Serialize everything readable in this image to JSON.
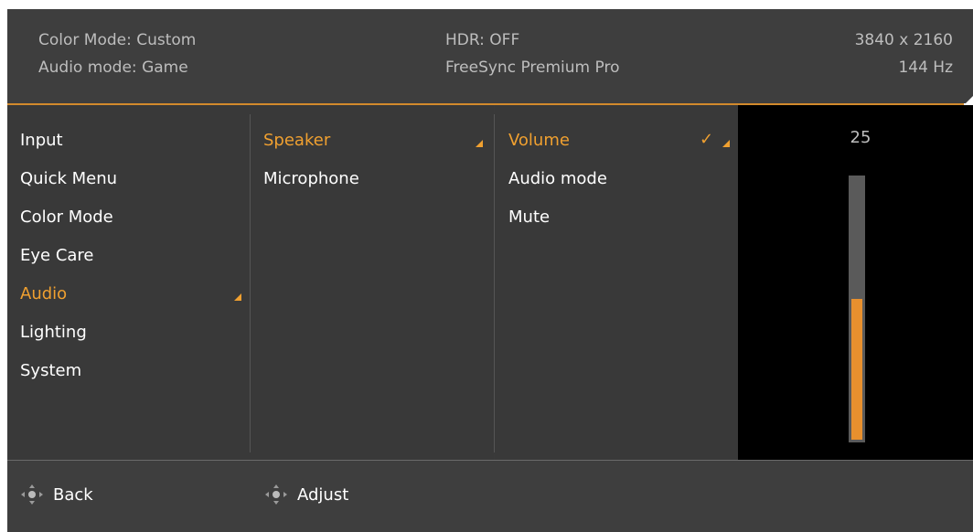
{
  "header": {
    "color_mode": "Color Mode: Custom",
    "audio_mode": "Audio mode: Game",
    "hdr": "HDR: OFF",
    "freesync": "FreeSync Premium Pro",
    "resolution": "3840 x 2160",
    "refresh": "144 Hz"
  },
  "main_menu": {
    "items": [
      {
        "label": "Input"
      },
      {
        "label": "Quick Menu"
      },
      {
        "label": "Color Mode"
      },
      {
        "label": "Eye Care"
      },
      {
        "label": "Audio",
        "selected": true
      },
      {
        "label": "Lighting"
      },
      {
        "label": "System"
      }
    ]
  },
  "sub_menu": {
    "items": [
      {
        "label": "Speaker",
        "selected": true
      },
      {
        "label": "Microphone"
      }
    ]
  },
  "option_menu": {
    "items": [
      {
        "label": "Volume",
        "selected": true,
        "checked": true
      },
      {
        "label": "Audio mode"
      },
      {
        "label": "Mute"
      }
    ]
  },
  "volume": {
    "value": "25",
    "level_fraction": 0.54
  },
  "footer": {
    "back_label": "Back",
    "adjust_label": "Adjust"
  },
  "colors": {
    "accent": "#f0a030",
    "background": "#3a3a3a",
    "text": "#ffffff"
  },
  "icons": {
    "selected_arrow": "triangle-corner-icon",
    "checked": "check-icon",
    "navigation": "joystick-icon"
  }
}
